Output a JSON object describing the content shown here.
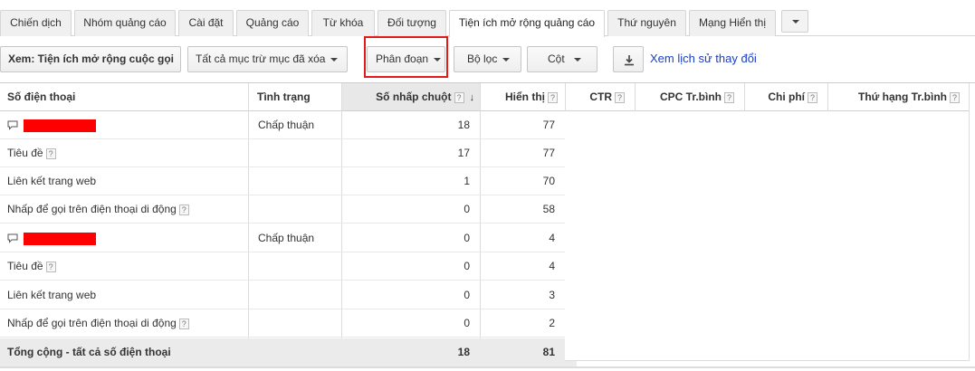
{
  "tabs": [
    {
      "label": "Chiến dịch",
      "active": false
    },
    {
      "label": "Nhóm quảng cáo",
      "active": false
    },
    {
      "label": "Cài đặt",
      "active": false
    },
    {
      "label": "Quảng cáo",
      "active": false
    },
    {
      "label": "Từ khóa",
      "active": false
    },
    {
      "label": "Đối tượng",
      "active": false
    },
    {
      "label": "Tiện ích mở rộng quảng cáo",
      "active": true
    },
    {
      "label": "Thứ nguyên",
      "active": false
    },
    {
      "label": "Mạng Hiển thị",
      "active": false
    }
  ],
  "toolbar": {
    "view_label": "Xem: Tiện ích mở rộng cuộc gọi",
    "all_items_label": "Tất cả mục trừ mục đã xóa",
    "segment_label": "Phân đoạn",
    "filter_label": "Bộ lọc",
    "columns_label": "Cột",
    "history_link": "Xem lịch sử thay đổi"
  },
  "columns": {
    "phone": "Số điện thoại",
    "status": "Tình trạng",
    "clicks": "Số nhấp chuột",
    "impressions": "Hiển thị",
    "ctr": "CTR",
    "avg_cpc": "CPC Tr.bình",
    "cost": "Chi phí",
    "avg_pos": "Thứ hạng Tr.bình"
  },
  "help_mark": "?",
  "sort_arrow": "↓",
  "rows": [
    {
      "label": "",
      "status": "Chấp thuận",
      "clicks": "18",
      "impressions": "77"
    },
    {
      "label": "Tiêu đề",
      "status": "",
      "clicks": "17",
      "impressions": "77"
    },
    {
      "label": "Liên kết trang web",
      "status": "",
      "clicks": "1",
      "impressions": "70"
    },
    {
      "label": "Nhấp để gọi trên điện thoại di động",
      "status": "",
      "clicks": "0",
      "impressions": "58"
    },
    {
      "label": "",
      "status": "Chấp thuận",
      "clicks": "0",
      "impressions": "4"
    },
    {
      "label": "Tiêu đề",
      "status": "",
      "clicks": "0",
      "impressions": "4"
    },
    {
      "label": "Liên kết trang web",
      "status": "",
      "clicks": "0",
      "impressions": "3"
    },
    {
      "label": "Nhấp để gọi trên điện thoại di động",
      "status": "",
      "clicks": "0",
      "impressions": "2"
    }
  ],
  "total": {
    "label": "Tổng cộng - tất cả số điện thoại",
    "clicks": "18",
    "impressions": "81"
  },
  "colors": {
    "highlight": "#e21a1a",
    "link": "#1a3ec2",
    "redaction": "#ff0000",
    "sorted_header": "#e8e8e8",
    "total_row": "#ebebeb"
  }
}
